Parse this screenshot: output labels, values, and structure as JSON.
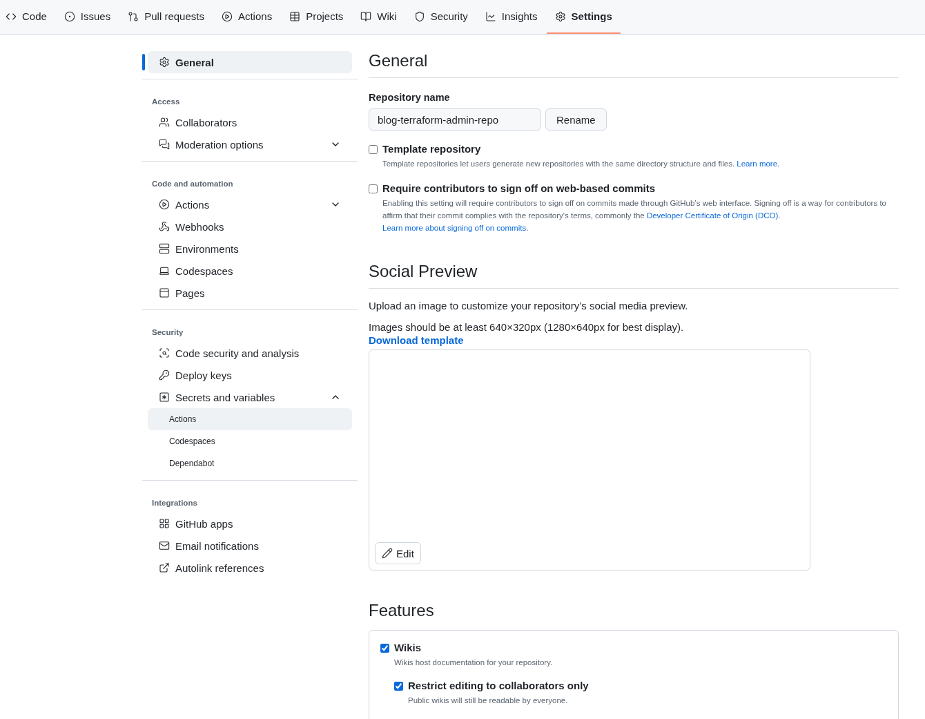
{
  "tabs": [
    {
      "label": "Code",
      "selected": false
    },
    {
      "label": "Issues",
      "selected": false
    },
    {
      "label": "Pull requests",
      "selected": false
    },
    {
      "label": "Actions",
      "selected": false
    },
    {
      "label": "Projects",
      "selected": false
    },
    {
      "label": "Wiki",
      "selected": false
    },
    {
      "label": "Security",
      "selected": false
    },
    {
      "label": "Insights",
      "selected": false
    },
    {
      "label": "Settings",
      "selected": true
    }
  ],
  "sidebar": {
    "top": {
      "label": "General",
      "selected": true
    },
    "sections": [
      {
        "heading": "Access",
        "items": [
          {
            "label": "Collaborators",
            "selected": false
          },
          {
            "label": "Moderation options",
            "selected": false,
            "expanded": false
          }
        ]
      },
      {
        "heading": "Code and automation",
        "items": [
          {
            "label": "Actions",
            "selected": false,
            "expanded": false
          },
          {
            "label": "Webhooks",
            "selected": false
          },
          {
            "label": "Environments",
            "selected": false
          },
          {
            "label": "Codespaces",
            "selected": false
          },
          {
            "label": "Pages",
            "selected": false
          }
        ]
      },
      {
        "heading": "Security",
        "items": [
          {
            "label": "Code security and analysis",
            "selected": false
          },
          {
            "label": "Deploy keys",
            "selected": false
          },
          {
            "label": "Secrets and variables",
            "selected": false,
            "expanded": true,
            "children": [
              {
                "label": "Actions",
                "selected": true
              },
              {
                "label": "Codespaces",
                "selected": false
              },
              {
                "label": "Dependabot",
                "selected": false
              }
            ]
          }
        ]
      },
      {
        "heading": "Integrations",
        "items": [
          {
            "label": "GitHub apps",
            "selected": false
          },
          {
            "label": "Email notifications",
            "selected": false
          },
          {
            "label": "Autolink references",
            "selected": false
          }
        ]
      }
    ]
  },
  "general": {
    "title": "General",
    "repo_name_label": "Repository name",
    "repo_name_value": "blog-terraform-admin-repo",
    "rename_button": "Rename",
    "options": [
      {
        "label": "Template repository",
        "checked": false,
        "description": [
          {
            "kind": "text",
            "text": "Template repositories let users generate new repositories with the same directory structure and files. "
          },
          {
            "kind": "link",
            "text": "Learn more"
          },
          {
            "kind": "text",
            "text": "."
          }
        ]
      },
      {
        "label": "Require contributors to sign off on web-based commits",
        "checked": false,
        "description": [
          {
            "kind": "text",
            "text": "Enabling this setting will require contributors to sign off on commits made through GitHub’s web interface. Signing off is a way for contributors to affirm that their commit complies with the repository's terms, commonly the "
          },
          {
            "kind": "link",
            "text": "Developer Certificate of Origin (DCO)"
          },
          {
            "kind": "text",
            "text": ". "
          },
          {
            "kind": "link",
            "text": "Learn more about signing off on commits"
          },
          {
            "kind": "text",
            "text": "."
          }
        ]
      }
    ]
  },
  "social_preview": {
    "title": "Social Preview",
    "intro": "Upload an image to customize your repository’s social media preview.",
    "size_note": "Images should be at least 640×320px (1280×640px for best display).",
    "download_link": "Download template",
    "edit_button": "Edit"
  },
  "features": {
    "title": "Features",
    "options": [
      {
        "label": "Wikis",
        "checked": true,
        "description": "Wikis host documentation for your repository.",
        "children": [
          {
            "label": "Restrict editing to collaborators only",
            "checked": true,
            "description": "Public wikis will still be readable by everyone."
          }
        ]
      }
    ]
  }
}
